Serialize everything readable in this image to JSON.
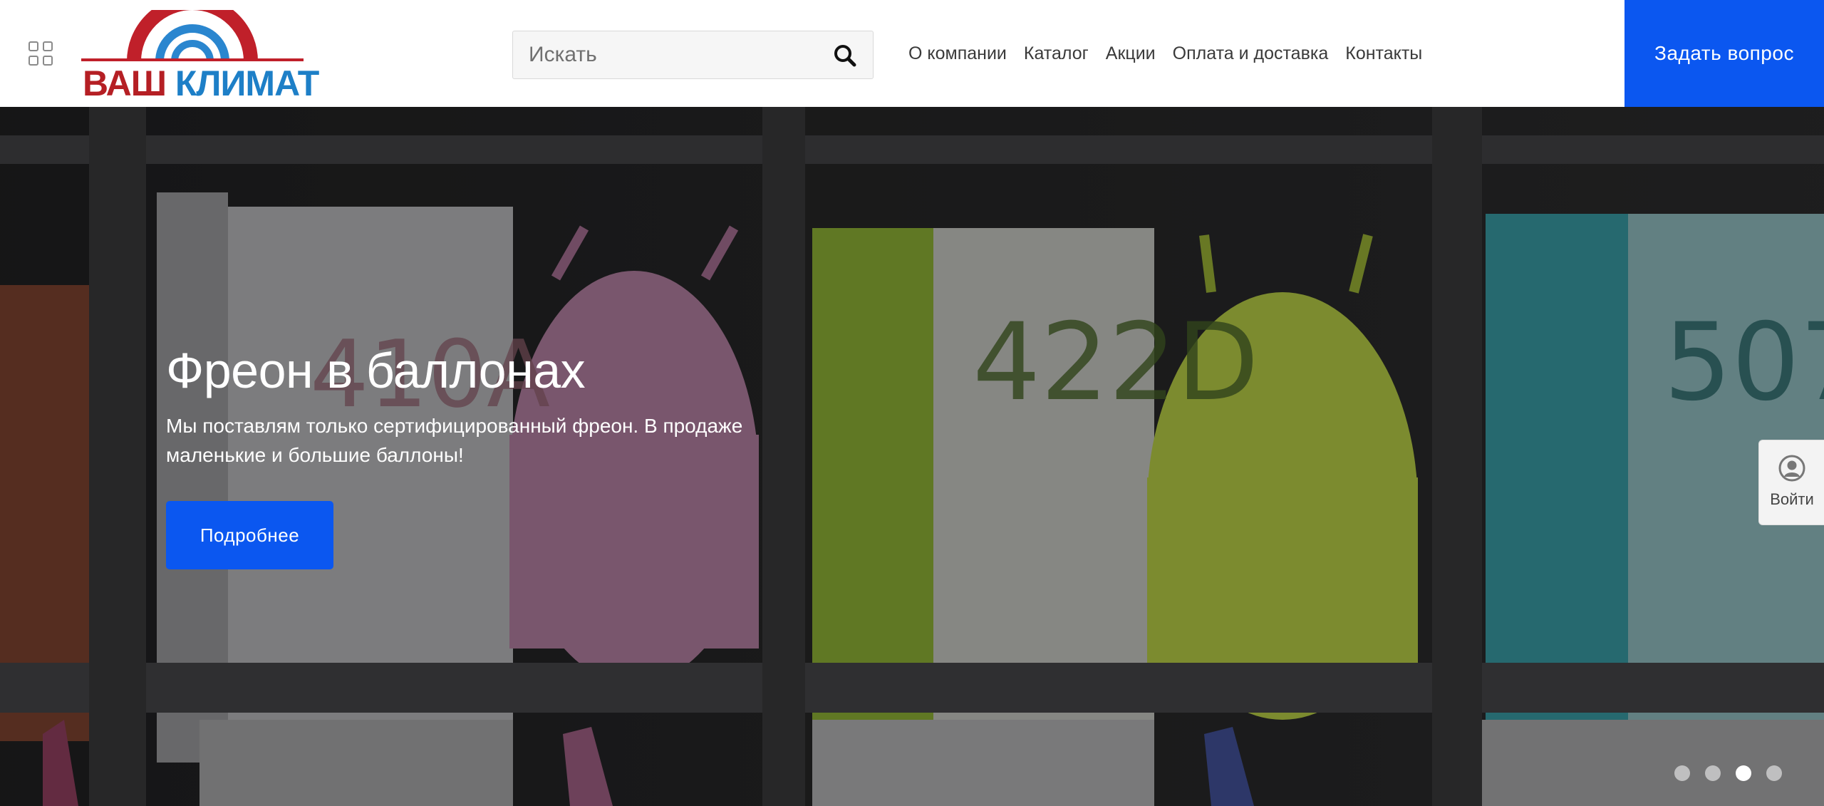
{
  "header": {
    "logo": {
      "word1": "ВАШ",
      "word2": "КЛИМАТ"
    },
    "search": {
      "placeholder": "Искать",
      "value": ""
    },
    "nav": [
      "О компании",
      "Каталог",
      "Акции",
      "Оплата и доставка",
      "Контакты"
    ],
    "ask_button": "Задать вопрос"
  },
  "hero": {
    "title": "Фреон в баллонах",
    "text": "Мы поставлям только сертифицированный фреон. В продаже маленькие и большие баллоны!",
    "button": "Подробнее",
    "slides_total": 4,
    "active_slide": 3
  },
  "login": {
    "label": "Войти"
  },
  "icons": [
    "menu-grid-icon",
    "search-icon",
    "user-icon"
  ],
  "colors": {
    "accent": "#0b57f0",
    "logo_red": "#b51f24",
    "logo_blue": "#1d7fc7"
  }
}
